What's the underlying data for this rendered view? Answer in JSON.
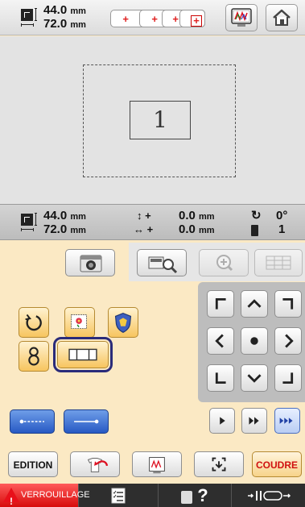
{
  "top": {
    "size_icon": "size-icon",
    "height": "44.0",
    "width": "72.0",
    "unit": "mm",
    "hoop_icon": "hoop-sizes-icon",
    "pattern_icon": "embroidery-frame-icon",
    "home_icon": "home-icon"
  },
  "preview": {
    "design_label": "1"
  },
  "info": {
    "height": "44.0",
    "width": "72.0",
    "unit": "mm",
    "v_offset": "0.0",
    "h_offset": "0.0",
    "rotation": "0°",
    "color_count": "1"
  },
  "buttons": {
    "edition": "EDITION",
    "coudre": "COUDRE"
  },
  "status": {
    "lock": "VERROUILLAGE",
    "help": "?"
  },
  "colors": {
    "orange": "#f7c55f",
    "blue": "#2759c4",
    "selected_outline": "#2a2b7a",
    "warning": "#e8101a",
    "coudre_text": "#d01010"
  }
}
